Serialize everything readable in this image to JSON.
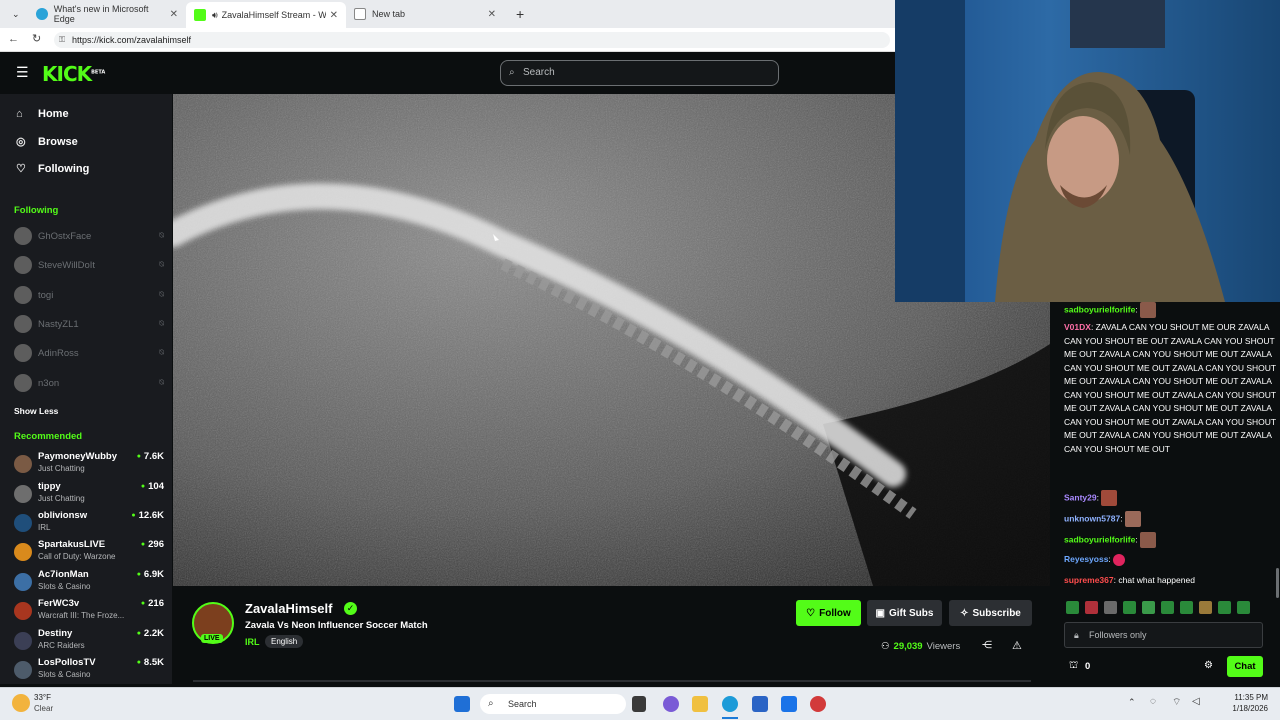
{
  "browser": {
    "tabs": [
      {
        "title": "What's new in Microsoft Edge",
        "active": false
      },
      {
        "title": "ZavalaHimself Stream - Watch",
        "active": true
      },
      {
        "title": "New tab",
        "active": false
      }
    ],
    "url": "https://kick.com/zavalahimself"
  },
  "header": {
    "logo": "KICK",
    "logo_badge": "BETA",
    "search_placeholder": "Search"
  },
  "sidebar": {
    "nav": [
      {
        "label": "Home",
        "icon": "home-icon"
      },
      {
        "label": "Browse",
        "icon": "compass-icon"
      },
      {
        "label": "Following",
        "icon": "heart-icon"
      }
    ],
    "following_title": "Following",
    "following": [
      "GhOstxFace",
      "SteveWillDoIt",
      "togi",
      "NastyZL1",
      "AdinRoss",
      "n3on"
    ],
    "show_less": "Show Less",
    "recommended_title": "Recommended",
    "recommended": [
      {
        "name": "PaymoneyWubby",
        "category": "Just Chatting",
        "viewers": "7.6K",
        "color": "#7a5a44"
      },
      {
        "name": "tippy",
        "category": "Just Chatting",
        "viewers": "104",
        "color": "#6e6e6e"
      },
      {
        "name": "oblivionsw",
        "category": "IRL",
        "viewers": "12.6K",
        "color": "#1f4e7a"
      },
      {
        "name": "SpartakusLIVE",
        "category": "Call of Duty: Warzone",
        "viewers": "296",
        "color": "#d98a1c"
      },
      {
        "name": "Ac7ionMan",
        "category": "Slots & Casino",
        "viewers": "6.9K",
        "color": "#3c6fa5"
      },
      {
        "name": "FerWC3v",
        "category": "Warcraft III: The Froze...",
        "viewers": "216",
        "color": "#a8361f"
      },
      {
        "name": "Destiny",
        "category": "ARC Raiders",
        "viewers": "2.2K",
        "color": "#3b3f55"
      },
      {
        "name": "LosPollosTV",
        "category": "Slots & Casino",
        "viewers": "8.5K",
        "color": "#4d5b6a"
      }
    ]
  },
  "stream": {
    "channel": "ZavalaHimself",
    "title": "Zavala Vs Neon Influencer Soccer Match",
    "category": "IRL",
    "tag": "English",
    "live_badge": "LIVE",
    "viewers": "29,039",
    "viewers_label": "Viewers",
    "follow_label": "Follow",
    "gift_label": "Gift Subs",
    "subscribe_label": "Subscribe"
  },
  "chat": {
    "messages": [
      {
        "user": "sadboyurielforlife",
        "color": "#53fc18",
        "text": ""
      },
      {
        "user": "V01DX",
        "color": "#ff6fa8",
        "text": "ZAVALA CAN YOU SHOUT ME OUR ZAVALA CAN YOU SHOUT BE OUT ZAVALA CAN YOU SHOUT ME OUT ZAVALA CAN YOU SHOUT ME OUT ZAVALA CAN YOU SHOUT ME OUT ZAVALA CAN YOU SHOUT ME OUT ZAVALA CAN YOU SHOUT ME OUT ZAVALA CAN YOU SHOUT ME OUT ZAVALA CAN YOU SHOUT ME OUT ZAVALA CAN YOU SHOUT ME OUT ZAVALA CAN YOU SHOUT ME OUT ZAVALA CAN YOU SHOUT ME OUT ZAVALA CAN YOU SHOUT ME OUT ZAVALA CAN YOU SHOUT ME OUT"
      },
      {
        "user": "Santy29",
        "color": "#a989ff",
        "text": ""
      },
      {
        "user": "unknown5787",
        "color": "#8fb2ff",
        "text": ""
      },
      {
        "user": "sadboyurielforlife",
        "color": "#53fc18",
        "text": ""
      },
      {
        "user": "Reyesyoss",
        "color": "#6ea8ff",
        "text": ""
      },
      {
        "user": "supreme367",
        "color": "#ff4d4d",
        "text": "chat what happened"
      }
    ],
    "followers_only": "Followers only",
    "points": "0",
    "chat_button": "Chat"
  },
  "taskbar": {
    "weather_temp": "33°F",
    "weather_desc": "Clear",
    "search_label": "Search",
    "time": "11:35 PM",
    "date": "1/18/2026"
  }
}
